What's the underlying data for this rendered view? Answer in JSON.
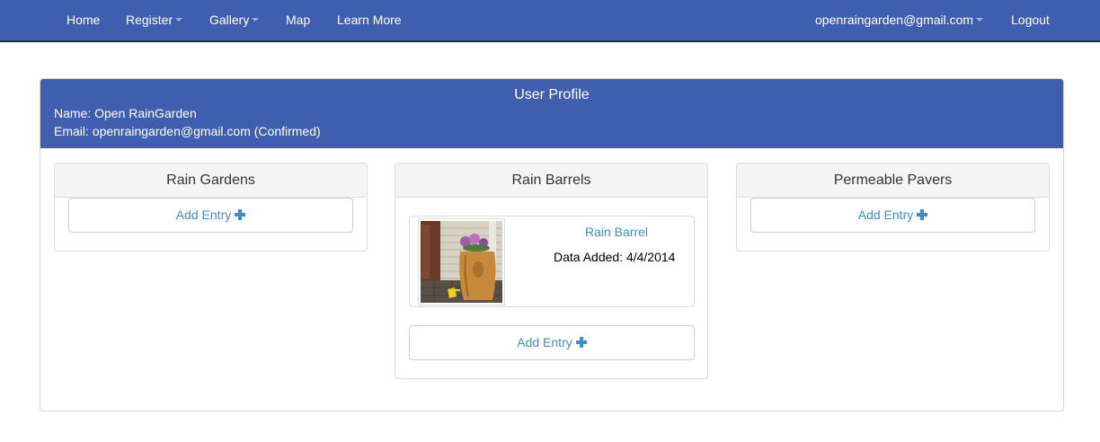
{
  "nav": {
    "home": "Home",
    "register": "Register",
    "gallery": "Gallery",
    "map": "Map",
    "learn_more": "Learn More",
    "account": "openraingarden@gmail.com",
    "logout": "Logout"
  },
  "profile": {
    "title": "User Profile",
    "name_line": "Name: Open RainGarden",
    "email_line": "Email: openraingarden@gmail.com (Confirmed)"
  },
  "columns": {
    "rain_gardens": {
      "heading": "Rain Gardens",
      "add_label": "Add Entry"
    },
    "rain_barrels": {
      "heading": "Rain Barrels",
      "add_label": "Add Entry",
      "entry": {
        "title": "Rain Barrel",
        "date_text": "Data Added: 4/4/2014"
      }
    },
    "permeable_pavers": {
      "heading": "Permeable Pavers",
      "add_label": "Add Entry"
    }
  },
  "colors": {
    "brand_blue": "#3f5fae",
    "link_blue": "#428bca"
  },
  "icons": [
    "caret-down-icon",
    "plus-icon"
  ]
}
